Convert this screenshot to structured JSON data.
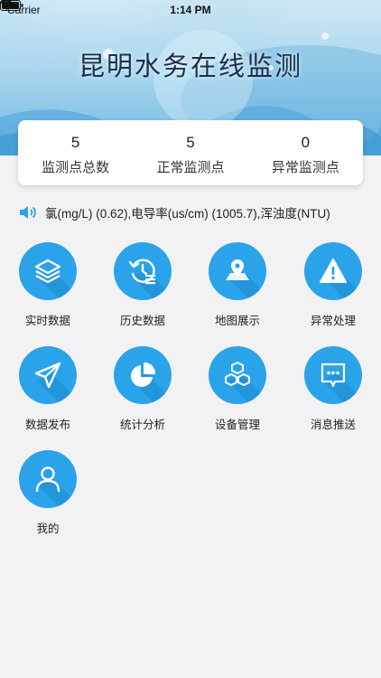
{
  "status_bar": {
    "carrier": "Carrier",
    "time": "1:14 PM"
  },
  "app_title": "昆明水务在线监测",
  "stats": [
    {
      "value": "5",
      "label": "监测点总数"
    },
    {
      "value": "5",
      "label": "正常监测点"
    },
    {
      "value": "0",
      "label": "异常监测点"
    }
  ],
  "ticker": {
    "text": "氯(mg/L) (0.62),电导率(us/cm) (1005.7),浑浊度(NTU)"
  },
  "menu": [
    {
      "label": "实时数据",
      "icon": "layers-icon"
    },
    {
      "label": "历史数据",
      "icon": "history-icon"
    },
    {
      "label": "地图展示",
      "icon": "map-icon"
    },
    {
      "label": "异常处理",
      "icon": "warning-icon"
    },
    {
      "label": "数据发布",
      "icon": "send-icon"
    },
    {
      "label": "统计分析",
      "icon": "pie-chart-icon"
    },
    {
      "label": "设备管理",
      "icon": "boxes-icon"
    },
    {
      "label": "消息推送",
      "icon": "message-icon"
    },
    {
      "label": "我的",
      "icon": "user-icon"
    }
  ],
  "colors": {
    "accent": "#2aa3ea",
    "background": "#f2f2f4"
  }
}
